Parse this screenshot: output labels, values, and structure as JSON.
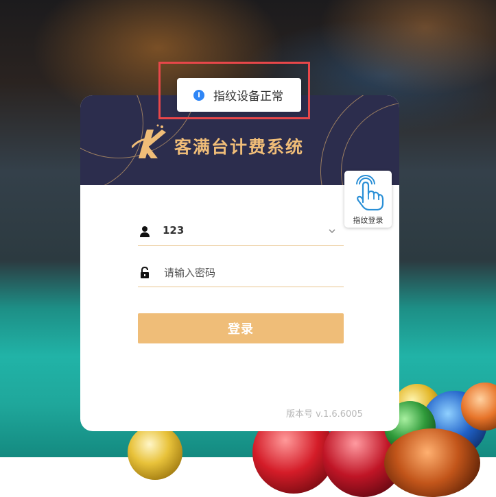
{
  "brand": {
    "title": "客满台计费系统",
    "logo_icon": "k-logo-icon"
  },
  "toast": {
    "icon": "info-icon",
    "message": "指纹设备正常"
  },
  "fingerprint_login": {
    "icon": "fingerprint-hand-icon",
    "label": "指纹登录"
  },
  "form": {
    "username": {
      "icon": "user-icon",
      "value": "123",
      "dropdown_icon": "chevron-down-icon"
    },
    "password": {
      "icon": "lock-icon",
      "placeholder": "请输入密码"
    },
    "login_label": "登录"
  },
  "footer": {
    "version": "版本号 v.1.6.6005"
  },
  "colors": {
    "accent": "#efbd78",
    "header_bg": "#2c2d4d",
    "highlight": "#e8474a",
    "info": "#2f86f6"
  }
}
